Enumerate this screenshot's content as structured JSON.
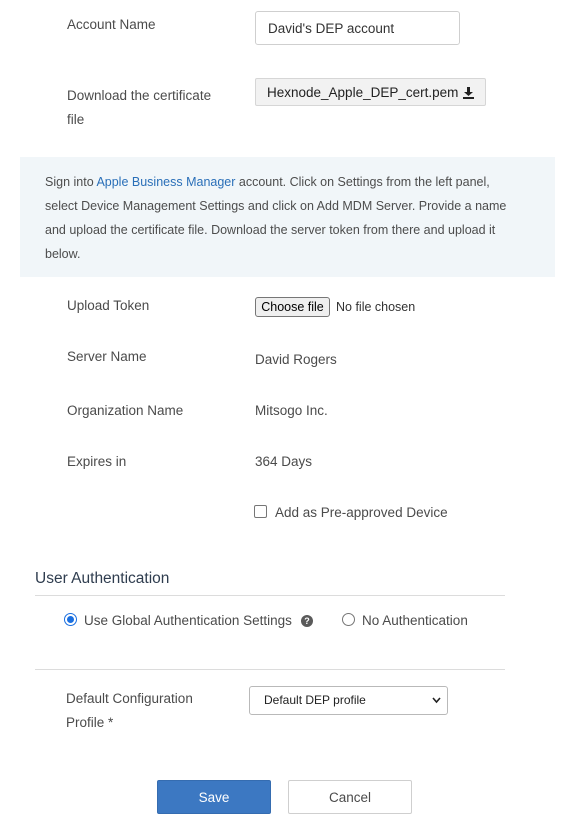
{
  "account": {
    "label": "Account Name",
    "value": "David's DEP account"
  },
  "certificate": {
    "label_line1": "Download the certificate",
    "label_line2": "file",
    "file_name": "Hexnode_Apple_DEP_cert.pem",
    "icon": "download-icon"
  },
  "info": {
    "prefix": "Sign into ",
    "link": "Apple Business Manager",
    "rest_line1": " account. Click on Settings from the left panel,",
    "line2": "select Device Management Settings and click on Add MDM Server. Provide a name",
    "line3": "and upload the certificate file. Download the server token from there and upload it",
    "line4": "below.",
    "link_color": "#2a6fb8"
  },
  "upload": {
    "label": "Upload Token",
    "button": "Choose file",
    "status": "No file chosen"
  },
  "server": {
    "label": "Server Name",
    "value": "David Rogers"
  },
  "organization": {
    "label": "Organization Name",
    "value": "Mitsogo Inc."
  },
  "expires": {
    "label": "Expires in",
    "value": "364 Days"
  },
  "preapproved": {
    "label": "Add as Pre-approved Device",
    "checked": false
  },
  "user_auth": {
    "title": "User Authentication",
    "options": [
      {
        "label": "Use Global Authentication Settings",
        "selected": true
      },
      {
        "label": "No Authentication",
        "selected": false
      }
    ],
    "help_icon": "question-circle-icon"
  },
  "config_profile": {
    "label_line1": "Default Configuration",
    "label_line2": "Profile *",
    "selected": "Default DEP profile"
  },
  "actions": {
    "save": "Save",
    "cancel": "Cancel"
  },
  "colors": {
    "primary": "#3c78c2",
    "panel_bg": "#f1f6f9",
    "radio_accent": "#1a6fe0"
  }
}
